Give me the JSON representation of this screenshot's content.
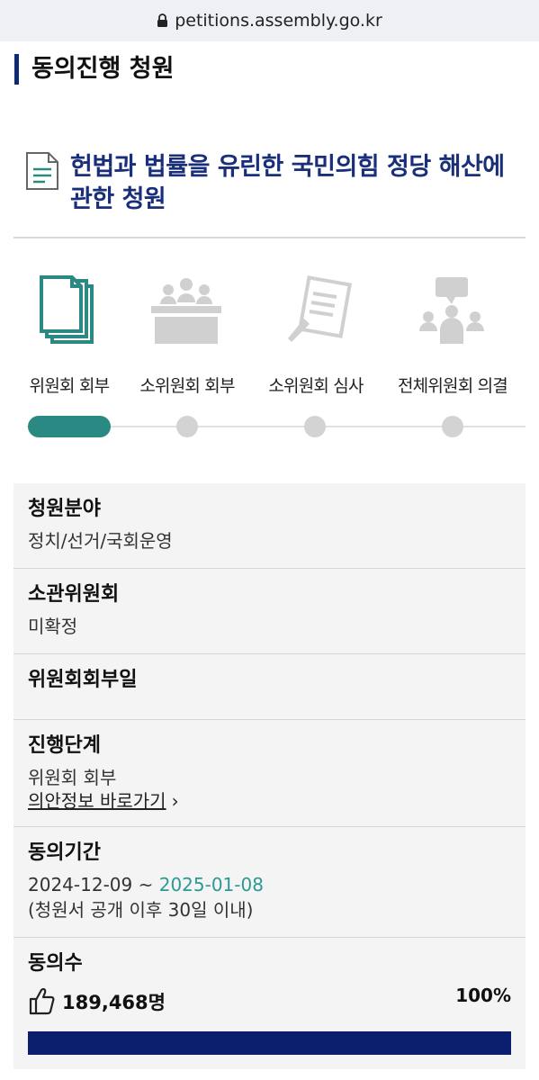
{
  "browser": {
    "url": "petitions.assembly.go.kr"
  },
  "page": {
    "heading": "동의진행 청원"
  },
  "petition": {
    "title": "헌법과 법률을 유린한 국민의힘 정당 해산에 관한 청원"
  },
  "steps": [
    {
      "label": "위원회 회부",
      "icon": "documents-icon",
      "active": true
    },
    {
      "label": "소위원회 회부",
      "icon": "meeting-table-icon",
      "active": false
    },
    {
      "label": "소위원회 심사",
      "icon": "review-pen-icon",
      "active": false
    },
    {
      "label": "전체위원회 의결",
      "icon": "plenary-icon",
      "active": false
    }
  ],
  "info": {
    "category_label": "청원분야",
    "category_value": "정치/선거/국회운영",
    "committee_label": "소관위원회",
    "committee_value": "미확정",
    "referral_date_label": "위원회회부일",
    "stage_label": "진행단계",
    "stage_value": "위원회 회부",
    "bill_link": "의안정보 바로가기",
    "period_label": "동의기간",
    "period_start": "2024-12-09",
    "period_sep": "~",
    "period_end": "2025-01-08",
    "period_note": "(청원서 공개 이후 30일 이내)",
    "agree_label": "동의수",
    "agree_count": "189,468명",
    "agree_percent": "100%",
    "agree_fraction": 1.0
  },
  "colors": {
    "accent": "#2a8a83",
    "title": "#1a2f7a",
    "bar": "#0c1f6e",
    "date_end": "#2a9a93"
  }
}
